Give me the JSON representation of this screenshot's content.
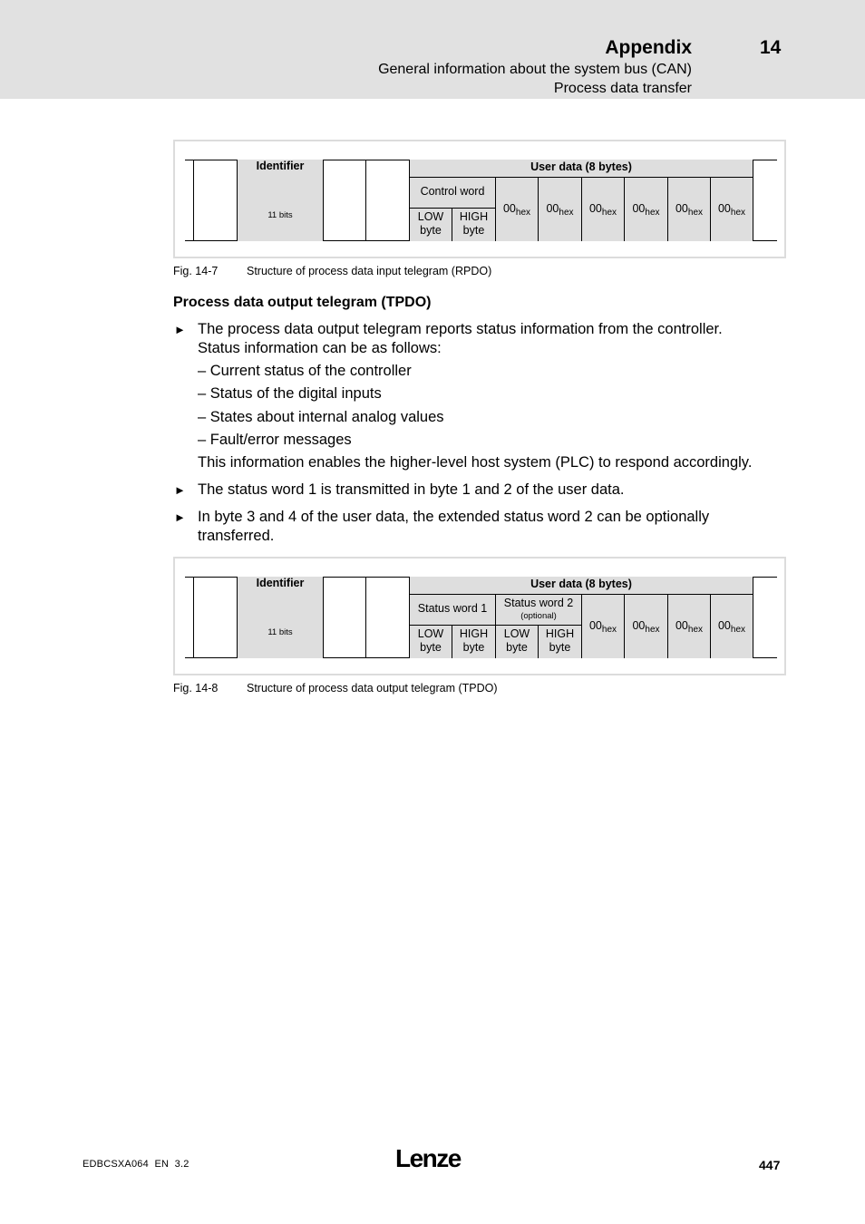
{
  "header": {
    "title": "Appendix",
    "chapter": "14",
    "subtitle_1": "General information about the system bus (CAN)",
    "subtitle_2": "Process data transfer"
  },
  "figure_rpdo": {
    "identifier_label": "Identifier",
    "identifier_bits": "11 bits",
    "user_data_label": "User data (8 bytes)",
    "control_word": "Control word",
    "low_byte": [
      "LOW",
      "byte"
    ],
    "high_byte": [
      "HIGH",
      "byte"
    ],
    "byte_values": [
      {
        "value": "00",
        "unit": "hex"
      },
      {
        "value": "00",
        "unit": "hex"
      },
      {
        "value": "00",
        "unit": "hex"
      },
      {
        "value": "00",
        "unit": "hex"
      },
      {
        "value": "00",
        "unit": "hex"
      },
      {
        "value": "00",
        "unit": "hex"
      }
    ],
    "caption_number": "Fig. 14-7",
    "caption_text": "Structure of process data input telegram (RPDO)"
  },
  "section": {
    "heading": "Process data output telegram (TPDO)",
    "bullet_1_lines": [
      "The process data output telegram reports status information from the controller.",
      "Status information can be as follows:"
    ],
    "sub_items": [
      "– Current status of the controller",
      "– Status of the digital inputs",
      "– States about internal analog values",
      "– Fault/error messages"
    ],
    "bullet_1_tail": "This information enables the higher-level host system (PLC) to respond accordingly.",
    "bullet_2": "The status word 1 is transmitted in byte 1 and 2 of the user data.",
    "bullet_3_lines": [
      "In byte 3 and 4 of the user data, the extended status word 2 can be optionally",
      "transferred."
    ],
    "bullet_glyph": "►"
  },
  "figure_tpdo": {
    "identifier_label": "Identifier",
    "identifier_bits": "11 bits",
    "user_data_label": "User data (8 bytes)",
    "status_word_1": "Status word 1",
    "status_word_2": "Status word 2",
    "status_word_2_note": "(optional)",
    "low_byte": [
      "LOW",
      "byte"
    ],
    "high_byte": [
      "HIGH",
      "byte"
    ],
    "byte_values": [
      {
        "value": "00",
        "unit": "hex"
      },
      {
        "value": "00",
        "unit": "hex"
      },
      {
        "value": "00",
        "unit": "hex"
      },
      {
        "value": "00",
        "unit": "hex"
      }
    ],
    "caption_number": "Fig. 14-8",
    "caption_text": "Structure of process data output telegram (TPDO)"
  },
  "footer": {
    "doc_id": "EDBCSXA064  EN  3.2",
    "logo": "Lenze",
    "page_number": "447"
  }
}
